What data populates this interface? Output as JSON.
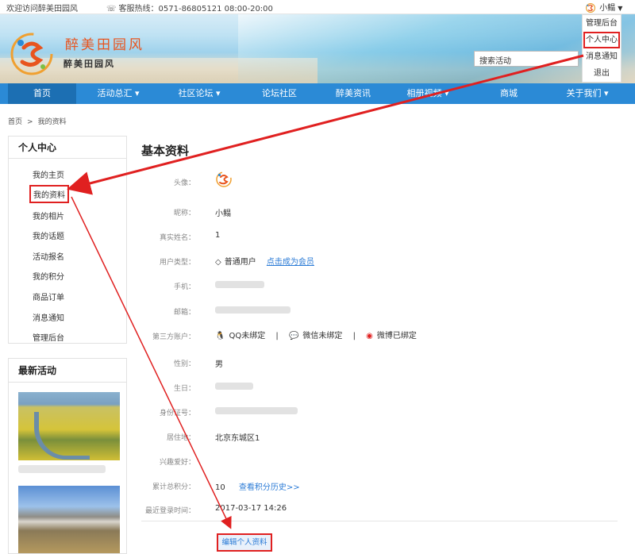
{
  "topbar": {
    "welcome": "欢迎访问醉美田园风",
    "hotline": "客服热线：0571-86805121 08:00-20:00",
    "username": "小鳎"
  },
  "header": {
    "logo_title": "醉美田园风",
    "logo_subtitle": "醉美田园风",
    "search_placeholder": "搜索活动"
  },
  "user_menu": {
    "items": [
      "管理后台",
      "个人中心",
      "消息通知",
      "退出"
    ],
    "highlighted": "个人中心"
  },
  "nav": {
    "items": [
      {
        "label": "首页",
        "has_dropdown": false
      },
      {
        "label": "活动总汇",
        "has_dropdown": true
      },
      {
        "label": "社区论坛",
        "has_dropdown": true
      },
      {
        "label": "论坛社区",
        "has_dropdown": false
      },
      {
        "label": "醉美资讯",
        "has_dropdown": false
      },
      {
        "label": "相册视频",
        "has_dropdown": true
      },
      {
        "label": "商城",
        "has_dropdown": false
      },
      {
        "label": "关于我们",
        "has_dropdown": true
      }
    ],
    "dropdown_arrow": "▾"
  },
  "breadcrumb": {
    "home": "首页",
    "separator": ">",
    "current": "我的资料"
  },
  "sidebar": {
    "title": "个人中心",
    "items": [
      "我的主页",
      "我的资料",
      "我的相片",
      "我的话题",
      "活动报名",
      "我的积分",
      "商品订单",
      "消息通知",
      "管理后台"
    ],
    "active": "我的资料"
  },
  "news": {
    "title": "最新活动"
  },
  "profile": {
    "title": "基本资料",
    "avatar_label": "头像：",
    "nickname_label": "昵称：",
    "nickname": "小鳎",
    "realname_label": "真实姓名：",
    "realname": "1",
    "usertype_label": "用户类型：",
    "usertype": "普通用户",
    "upgrade_link": "点击成为会员",
    "phone_label": "手机：",
    "email_label": "邮箱：",
    "thirdparty_label": "第三方账户：",
    "qq_status": "QQ未绑定",
    "wechat_status": "微信未绑定",
    "weibo_status": "微博已绑定",
    "divider_char": "|",
    "gender_label": "性别：",
    "gender": "男",
    "birthday_label": "生日：",
    "idcard_label": "身份证号：",
    "address_label": "居住地：",
    "address": "北京东城区1",
    "hobby_label": "兴趣爱好：",
    "points_label": "累计总积分：",
    "points": "10",
    "points_history_link": "查看积分历史>>",
    "lastlogin_label": "最近登录时间：",
    "lastlogin": "2017-03-17 14:26",
    "edit_button": "编辑个人资料"
  },
  "colors": {
    "nav_bg": "#2b8ad6",
    "nav_active": "#1c6fb3",
    "highlight_red": "#e02020",
    "link_blue": "#2b7bd6",
    "logo_orange": "#e8541e"
  }
}
